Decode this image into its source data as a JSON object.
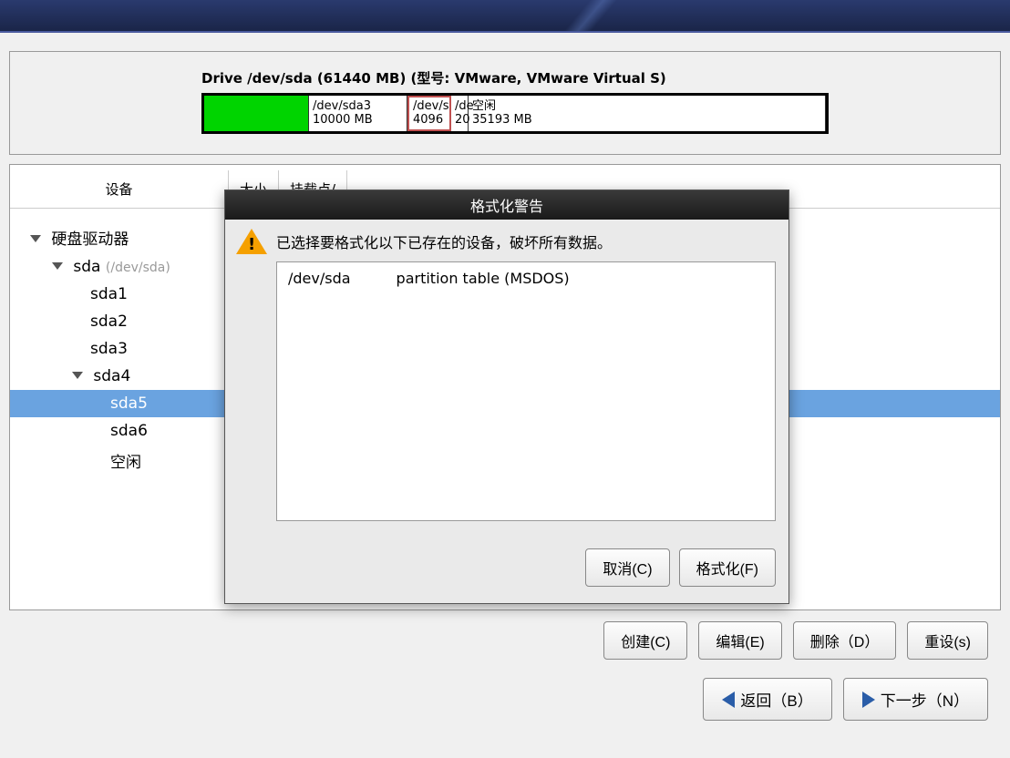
{
  "drive": {
    "title": "Drive /dev/sda (61440 MB) (型号: VMware, VMware Virtual S)",
    "segments": {
      "sda3": {
        "label": "/dev/sda3",
        "size": "10000 MB"
      },
      "p4096": {
        "label": "/dev/s",
        "size": "4096"
      },
      "p20": {
        "label": "/de",
        "size": "20"
      },
      "free": {
        "label": "空闲",
        "size": "35193 MB"
      }
    }
  },
  "columns": {
    "device": "设备",
    "size": "大小",
    "mount": "挂载点/"
  },
  "tree": {
    "root": "硬盘驱动器",
    "sda": "sda",
    "sda_hint": "(/dev/sda)",
    "sda1": "sda1",
    "sda2": "sda2",
    "sda3": "sda3",
    "sda4": "sda4",
    "sda5": "sda5",
    "sda6": "sda6",
    "free": "空闲"
  },
  "actions": {
    "create": "创建(C)",
    "edit": "编辑(E)",
    "delete": "删除（D）",
    "reset": "重设(s)"
  },
  "nav": {
    "back": "返回（B）",
    "next": "下一步（N）"
  },
  "modal": {
    "title": "格式化警告",
    "message": "已选择要格式化以下已存在的设备，破坏所有数据。",
    "item_dev": "/dev/sda",
    "item_desc": "partition table (MSDOS)",
    "cancel": "取消(C)",
    "format": "格式化(F)"
  }
}
